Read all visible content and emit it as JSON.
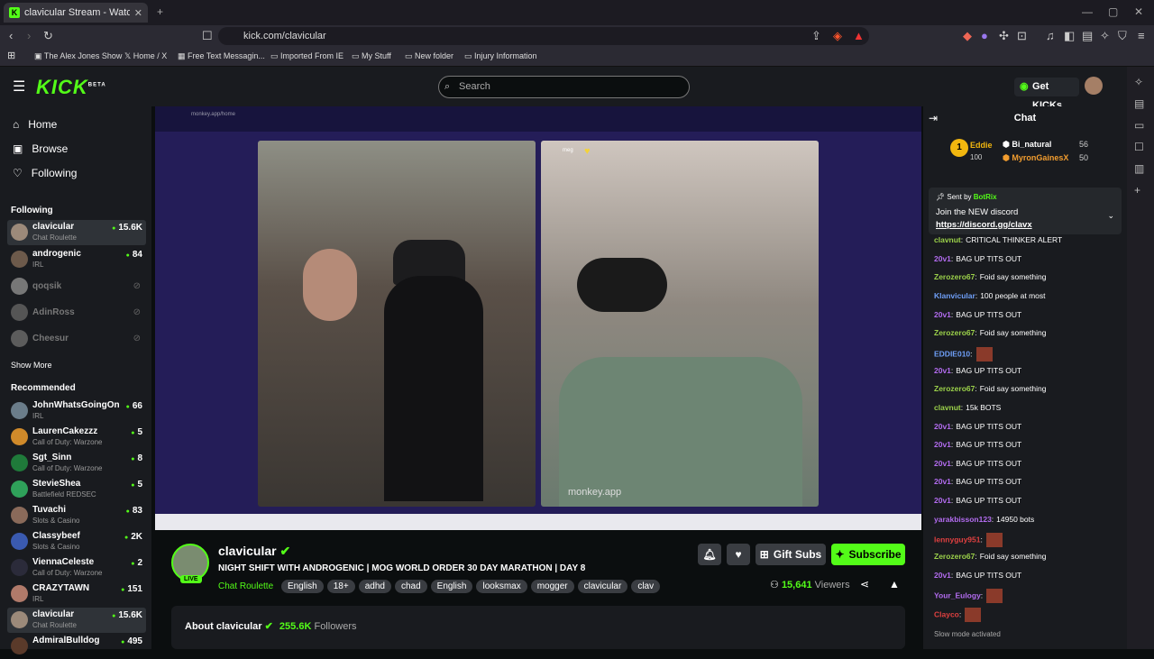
{
  "browser": {
    "tab_title": "clavicular Stream - Watch Liv",
    "url": "kick.com/clavicular"
  },
  "bookmarks": [
    "The Alex Jones Show",
    "Home / X",
    "Free Text Messagin...",
    "Imported From IE",
    "My Stuff",
    "New folder",
    "Injury Information"
  ],
  "header": {
    "logo": "KICK",
    "logo_sup": "BETA",
    "search_placeholder": "Search",
    "get_kicks": "Get KICKs"
  },
  "sidebar": {
    "nav": [
      {
        "label": "Home",
        "icon": "home-icon"
      },
      {
        "label": "Browse",
        "icon": "browse-icon"
      },
      {
        "label": "Following",
        "icon": "heart-icon"
      }
    ],
    "following_title": "Following",
    "following": [
      {
        "name": "clavicular",
        "category": "Chat Roulette",
        "viewers": "15.6K",
        "live": true
      },
      {
        "name": "androgenic",
        "category": "IRL",
        "viewers": "84",
        "live": true
      },
      {
        "name": "qoqsik",
        "category": "",
        "viewers": "",
        "live": false
      },
      {
        "name": "AdinRoss",
        "category": "",
        "viewers": "",
        "live": false
      },
      {
        "name": "Cheesur",
        "category": "",
        "viewers": "",
        "live": false
      }
    ],
    "show_more": "Show More",
    "recommended_title": "Recommended",
    "recommended": [
      {
        "name": "JohnWhatsGoingOn",
        "category": "IRL",
        "viewers": "66"
      },
      {
        "name": "LaurenCakezzz",
        "category": "Call of Duty: Warzone",
        "viewers": "5"
      },
      {
        "name": "Sgt_Sinn",
        "category": "Call of Duty: Warzone",
        "viewers": "8"
      },
      {
        "name": "StevieShea",
        "category": "Battlefield REDSEC",
        "viewers": "5"
      },
      {
        "name": "Tuvachi",
        "category": "Slots & Casino",
        "viewers": "83"
      },
      {
        "name": "Classybeef",
        "category": "Slots & Casino",
        "viewers": "2K"
      },
      {
        "name": "ViennaCeleste",
        "category": "Call of Duty: Warzone",
        "viewers": "2"
      },
      {
        "name": "CRAZYTAWN",
        "category": "IRL",
        "viewers": "151"
      },
      {
        "name": "clavicular",
        "category": "Chat Roulette",
        "viewers": "15.6K"
      },
      {
        "name": "AdmiralBulldog",
        "category": "",
        "viewers": "495"
      }
    ]
  },
  "video": {
    "left_window": "monkey.app/home",
    "right_user": "meg",
    "watermark": "monkey.app"
  },
  "stream": {
    "channel": "clavicular",
    "live_badge": "LIVE",
    "title": "NIGHT SHIFT WITH ANDROGENIC | MOG WORLD ORDER 30 DAY MARATHON | DAY 8",
    "category": "Chat Roulette",
    "tags": [
      "English",
      "18+",
      "adhd",
      "chad",
      "English",
      "looksmax",
      "mogger",
      "clavicular",
      "clav"
    ],
    "viewers": "15,641",
    "viewers_label": "Viewers",
    "gift_subs": "Gift Subs",
    "subscribe": "Subscribe",
    "about": "About clavicular",
    "followers": "255.6K",
    "followers_label": "Followers"
  },
  "chat": {
    "title": "Chat",
    "leaders": [
      {
        "name": "Eddie",
        "rank": "1",
        "amount": "100"
      },
      {
        "name": "Bi_natural",
        "amount": "56"
      },
      {
        "name": "MyronGainesX",
        "amount": "50"
      }
    ],
    "pinned": {
      "sent_by": "Sent by",
      "bot": "BotRix",
      "text": "Join the NEW discord",
      "link": "https://discord.gg/clavx"
    },
    "messages": [
      {
        "user": "clavnut",
        "cls": "u1",
        "text": "CRITICAL THINKER ALERT"
      },
      {
        "user": "20v1",
        "cls": "u2",
        "text": "BAG UP TITS OUT"
      },
      {
        "user": "Zerozero67",
        "cls": "u1",
        "text": "Foid say something"
      },
      {
        "user": "Klanvicular",
        "cls": "u3",
        "text": "100 people at most"
      },
      {
        "user": "20v1",
        "cls": "u2",
        "text": "BAG UP TITS OUT"
      },
      {
        "user": "Zerozero67",
        "cls": "u1",
        "text": "Foid say something"
      },
      {
        "user": "EDDIE010",
        "cls": "u3",
        "text": ""
      },
      {
        "user": "20v1",
        "cls": "u2",
        "text": "BAG UP TITS OUT"
      },
      {
        "user": "Zerozero67",
        "cls": "u1",
        "text": "Foid say something"
      },
      {
        "user": "clavnut",
        "cls": "u1",
        "text": "15k BOTS"
      },
      {
        "user": "20v1",
        "cls": "u2",
        "text": "BAG UP TITS OUT"
      },
      {
        "user": "20v1",
        "cls": "u2",
        "text": "BAG UP TITS OUT"
      },
      {
        "user": "20v1",
        "cls": "u2",
        "text": "BAG UP TITS OUT"
      },
      {
        "user": "20v1",
        "cls": "u2",
        "text": "BAG UP TITS OUT"
      },
      {
        "user": "20v1",
        "cls": "u2",
        "text": "BAG UP TITS OUT"
      },
      {
        "user": "yarakbisson123",
        "cls": "u2",
        "text": "14950 bots"
      },
      {
        "user": "lennyguy951",
        "cls": "u4",
        "text": ""
      },
      {
        "user": "Zerozero67",
        "cls": "u1",
        "text": "Foid say something"
      },
      {
        "user": "20v1",
        "cls": "u2",
        "text": "BAG UP TITS OUT"
      },
      {
        "user": "Your_Eulogy",
        "cls": "u2",
        "text": ""
      },
      {
        "user": "Clayco",
        "cls": "u4",
        "text": ""
      }
    ],
    "slow_mode": "Slow mode activated"
  }
}
